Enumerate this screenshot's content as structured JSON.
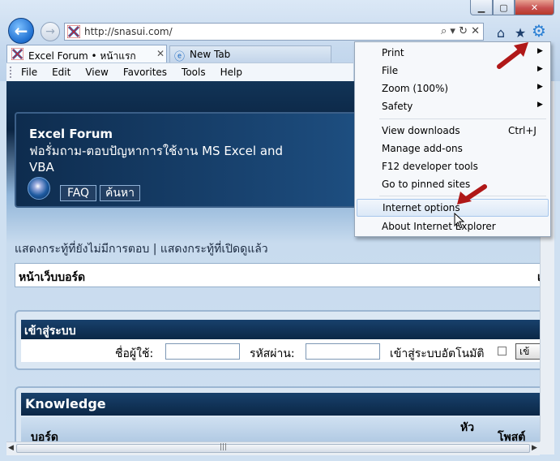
{
  "browser": {
    "url": "http://snasui.com/",
    "tabs": [
      {
        "label": "Excel Forum • หน้าแรก",
        "close": "✕"
      },
      {
        "label": "New Tab"
      }
    ],
    "menubar": [
      "File",
      "Edit",
      "View",
      "Favorites",
      "Tools",
      "Help"
    ],
    "address_tools": "⌕ ▾ ↻ ✕"
  },
  "tools_menu": {
    "items": [
      {
        "label": "Print",
        "submenu": true
      },
      {
        "label": "File",
        "submenu": true
      },
      {
        "label": "Zoom (100%)",
        "submenu": true
      },
      {
        "label": "Safety",
        "submenu": true
      },
      {
        "label": "View downloads",
        "shortcut": "Ctrl+J"
      },
      {
        "label": "Manage add-ons"
      },
      {
        "label": "F12 developer tools"
      },
      {
        "label": "Go to pinned sites"
      },
      {
        "label": "Internet options",
        "highlighted": true
      },
      {
        "label": "About Internet Explorer"
      }
    ]
  },
  "page": {
    "forum_title": "Excel Forum",
    "forum_desc": "ฟอรั่มถาม-ตอบปัญหาการใช้งาน MS Excel and VBA",
    "faq": "FAQ",
    "search": "ค้นหา",
    "quicklinks": "แสดงกระทู้ที่ยังไม่มีการตอบ | แสดงกระทู้ที่เปิดดูแล้ว",
    "board_index": "หน้าเว็บบอร์ด",
    "board_index_right": "เ",
    "login": {
      "title": "เข้าสู่ระบบ",
      "username_label": "ชื่อผู้ใช้:",
      "password_label": "รหัสผ่าน:",
      "auto_login_label": "เข้าสู่ระบบอัตโนมัติ",
      "button": "เข้"
    },
    "knowledge": {
      "title": "Knowledge",
      "col_board": "บอร์ด",
      "col_topics": "หัว",
      "col_posts": "โพสต์"
    }
  },
  "colors": {
    "annotation_arrow": "#b01818",
    "gear": "#2a7fd4"
  }
}
